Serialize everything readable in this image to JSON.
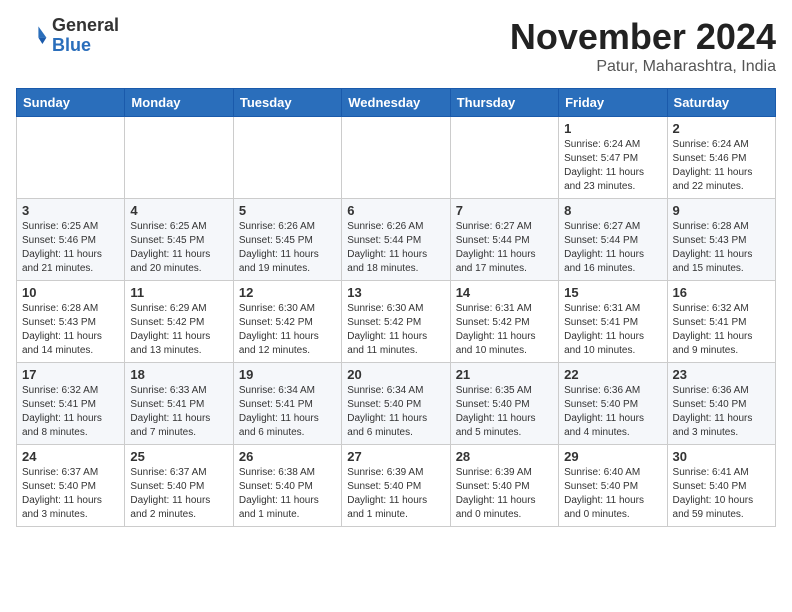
{
  "logo": {
    "text_general": "General",
    "text_blue": "Blue"
  },
  "header": {
    "month": "November 2024",
    "location": "Patur, Maharashtra, India"
  },
  "weekdays": [
    "Sunday",
    "Monday",
    "Tuesday",
    "Wednesday",
    "Thursday",
    "Friday",
    "Saturday"
  ],
  "weeks": [
    [
      {
        "day": "",
        "info": ""
      },
      {
        "day": "",
        "info": ""
      },
      {
        "day": "",
        "info": ""
      },
      {
        "day": "",
        "info": ""
      },
      {
        "day": "",
        "info": ""
      },
      {
        "day": "1",
        "info": "Sunrise: 6:24 AM\nSunset: 5:47 PM\nDaylight: 11 hours and 23 minutes."
      },
      {
        "day": "2",
        "info": "Sunrise: 6:24 AM\nSunset: 5:46 PM\nDaylight: 11 hours and 22 minutes."
      }
    ],
    [
      {
        "day": "3",
        "info": "Sunrise: 6:25 AM\nSunset: 5:46 PM\nDaylight: 11 hours and 21 minutes."
      },
      {
        "day": "4",
        "info": "Sunrise: 6:25 AM\nSunset: 5:45 PM\nDaylight: 11 hours and 20 minutes."
      },
      {
        "day": "5",
        "info": "Sunrise: 6:26 AM\nSunset: 5:45 PM\nDaylight: 11 hours and 19 minutes."
      },
      {
        "day": "6",
        "info": "Sunrise: 6:26 AM\nSunset: 5:44 PM\nDaylight: 11 hours and 18 minutes."
      },
      {
        "day": "7",
        "info": "Sunrise: 6:27 AM\nSunset: 5:44 PM\nDaylight: 11 hours and 17 minutes."
      },
      {
        "day": "8",
        "info": "Sunrise: 6:27 AM\nSunset: 5:44 PM\nDaylight: 11 hours and 16 minutes."
      },
      {
        "day": "9",
        "info": "Sunrise: 6:28 AM\nSunset: 5:43 PM\nDaylight: 11 hours and 15 minutes."
      }
    ],
    [
      {
        "day": "10",
        "info": "Sunrise: 6:28 AM\nSunset: 5:43 PM\nDaylight: 11 hours and 14 minutes."
      },
      {
        "day": "11",
        "info": "Sunrise: 6:29 AM\nSunset: 5:42 PM\nDaylight: 11 hours and 13 minutes."
      },
      {
        "day": "12",
        "info": "Sunrise: 6:30 AM\nSunset: 5:42 PM\nDaylight: 11 hours and 12 minutes."
      },
      {
        "day": "13",
        "info": "Sunrise: 6:30 AM\nSunset: 5:42 PM\nDaylight: 11 hours and 11 minutes."
      },
      {
        "day": "14",
        "info": "Sunrise: 6:31 AM\nSunset: 5:42 PM\nDaylight: 11 hours and 10 minutes."
      },
      {
        "day": "15",
        "info": "Sunrise: 6:31 AM\nSunset: 5:41 PM\nDaylight: 11 hours and 10 minutes."
      },
      {
        "day": "16",
        "info": "Sunrise: 6:32 AM\nSunset: 5:41 PM\nDaylight: 11 hours and 9 minutes."
      }
    ],
    [
      {
        "day": "17",
        "info": "Sunrise: 6:32 AM\nSunset: 5:41 PM\nDaylight: 11 hours and 8 minutes."
      },
      {
        "day": "18",
        "info": "Sunrise: 6:33 AM\nSunset: 5:41 PM\nDaylight: 11 hours and 7 minutes."
      },
      {
        "day": "19",
        "info": "Sunrise: 6:34 AM\nSunset: 5:41 PM\nDaylight: 11 hours and 6 minutes."
      },
      {
        "day": "20",
        "info": "Sunrise: 6:34 AM\nSunset: 5:40 PM\nDaylight: 11 hours and 6 minutes."
      },
      {
        "day": "21",
        "info": "Sunrise: 6:35 AM\nSunset: 5:40 PM\nDaylight: 11 hours and 5 minutes."
      },
      {
        "day": "22",
        "info": "Sunrise: 6:36 AM\nSunset: 5:40 PM\nDaylight: 11 hours and 4 minutes."
      },
      {
        "day": "23",
        "info": "Sunrise: 6:36 AM\nSunset: 5:40 PM\nDaylight: 11 hours and 3 minutes."
      }
    ],
    [
      {
        "day": "24",
        "info": "Sunrise: 6:37 AM\nSunset: 5:40 PM\nDaylight: 11 hours and 3 minutes."
      },
      {
        "day": "25",
        "info": "Sunrise: 6:37 AM\nSunset: 5:40 PM\nDaylight: 11 hours and 2 minutes."
      },
      {
        "day": "26",
        "info": "Sunrise: 6:38 AM\nSunset: 5:40 PM\nDaylight: 11 hours and 1 minute."
      },
      {
        "day": "27",
        "info": "Sunrise: 6:39 AM\nSunset: 5:40 PM\nDaylight: 11 hours and 1 minute."
      },
      {
        "day": "28",
        "info": "Sunrise: 6:39 AM\nSunset: 5:40 PM\nDaylight: 11 hours and 0 minutes."
      },
      {
        "day": "29",
        "info": "Sunrise: 6:40 AM\nSunset: 5:40 PM\nDaylight: 11 hours and 0 minutes."
      },
      {
        "day": "30",
        "info": "Sunrise: 6:41 AM\nSunset: 5:40 PM\nDaylight: 10 hours and 59 minutes."
      }
    ]
  ]
}
